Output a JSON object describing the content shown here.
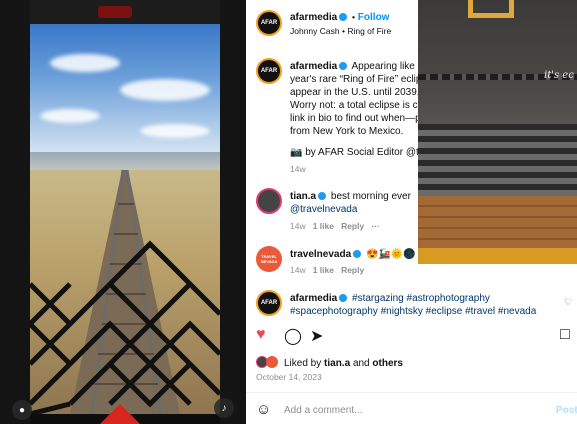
{
  "post": {
    "author": "afarmedia",
    "follow_label": "Follow",
    "separator": "•",
    "audio": "Johnny Cash • Ring of Fire",
    "avatar_text": "AFAR",
    "caption_lines": [
      "Appearing like a",
      "year's rare “Ring of Fire” eclip",
      "appear in the U.S. until 2039.",
      "Worry not: a total eclipse is c",
      "link in bio to find out when—p",
      "from New York to Mexico."
    ],
    "editor_line": "by AFAR Social Editor @tia",
    "caption_time": "14w"
  },
  "comments": [
    {
      "user": "tian.a",
      "text": "best morning ever",
      "mention": "@travelnevada",
      "time": "14w",
      "likes": "1 like",
      "reply": "Reply",
      "more": "···"
    },
    {
      "user": "travelnevada",
      "avatar_text": "TRAVEL NEVADA",
      "text": "😍🚂🌞🌑",
      "time": "14w",
      "likes": "1 like",
      "reply": "Reply"
    },
    {
      "user": "afarmedia",
      "line1": "#stargazing #astrophotography",
      "line2": "#spacephotography #nightsky #eclipse #travel #nevada"
    }
  ],
  "likes": {
    "prefix": "Liked by",
    "user": "tian.a",
    "and": "and",
    "others": "others"
  },
  "date": "October 14, 2023",
  "add_comment": {
    "placeholder": "Add a comment...",
    "post_label": "Post"
  },
  "overlay_caption": "it's ec",
  "colors": {
    "link": "#00376b",
    "accent": "#0095f6",
    "heart": "#ed4956"
  },
  "icons": [
    "heart-icon",
    "comment-icon",
    "share-icon",
    "bookmark-icon",
    "smiley-icon",
    "user-icon",
    "mute-icon",
    "verified-icon"
  ]
}
